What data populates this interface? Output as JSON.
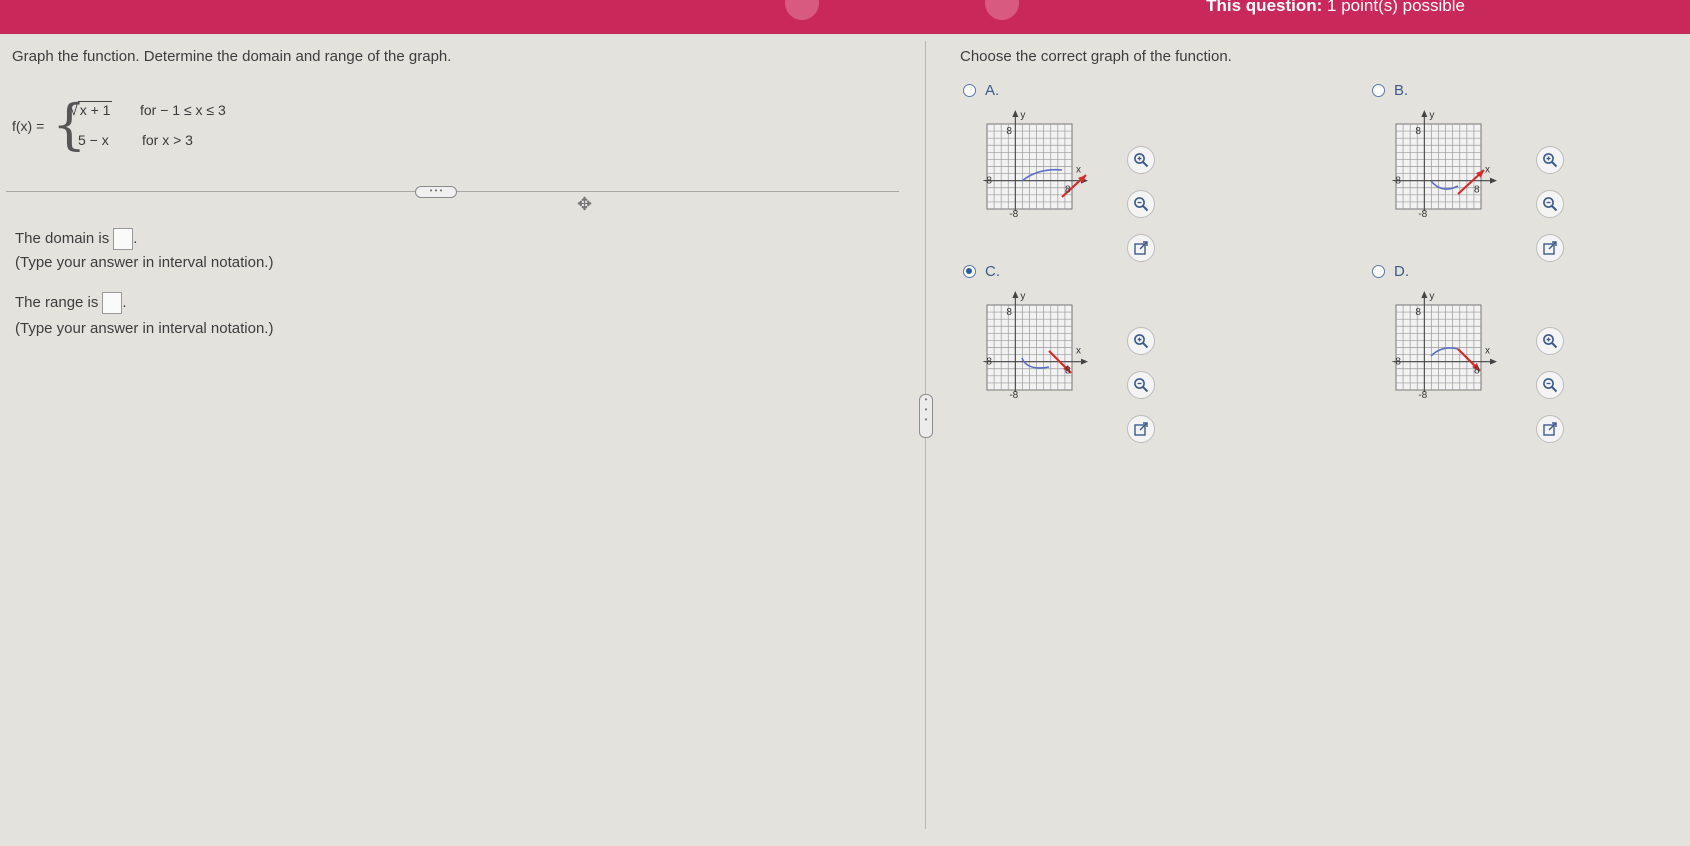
{
  "header": {
    "question_info_bold": "This question:",
    "question_info_rest": "1 point(s) possible"
  },
  "left": {
    "instruction": "Graph the function. Determine the domain and range of the graph.",
    "func_name": "f(x) =",
    "case1_expr": "x + 1",
    "case1_cond": "for  − 1 ≤ x ≤ 3",
    "case2_expr": "5 − x",
    "case2_cond": "for  x > 3",
    "domain_label": "The domain is",
    "domain_hint": "(Type your answer in interval notation.)",
    "range_label": "The range is",
    "range_hint": "(Type your answer in interval notation.)",
    "domain_value": "",
    "range_value": ""
  },
  "right": {
    "instruction": "Choose the correct graph of the function.",
    "options": [
      {
        "label": "A.",
        "selected": false
      },
      {
        "label": "B.",
        "selected": false
      },
      {
        "label": "C.",
        "selected": true
      },
      {
        "label": "D.",
        "selected": false
      }
    ]
  },
  "graph": {
    "axis_x": "x",
    "axis_y": "y",
    "tick_pos": "8",
    "tick_neg": "-8"
  },
  "colors": {
    "header": "#c8285a",
    "curve_blue": "#5a6fc4",
    "line_red": "#d42b2b",
    "radio": "#2d5c9e"
  },
  "icons": [
    "zoom-in-icon",
    "zoom-out-icon",
    "open-external-icon",
    "move-icon"
  ]
}
